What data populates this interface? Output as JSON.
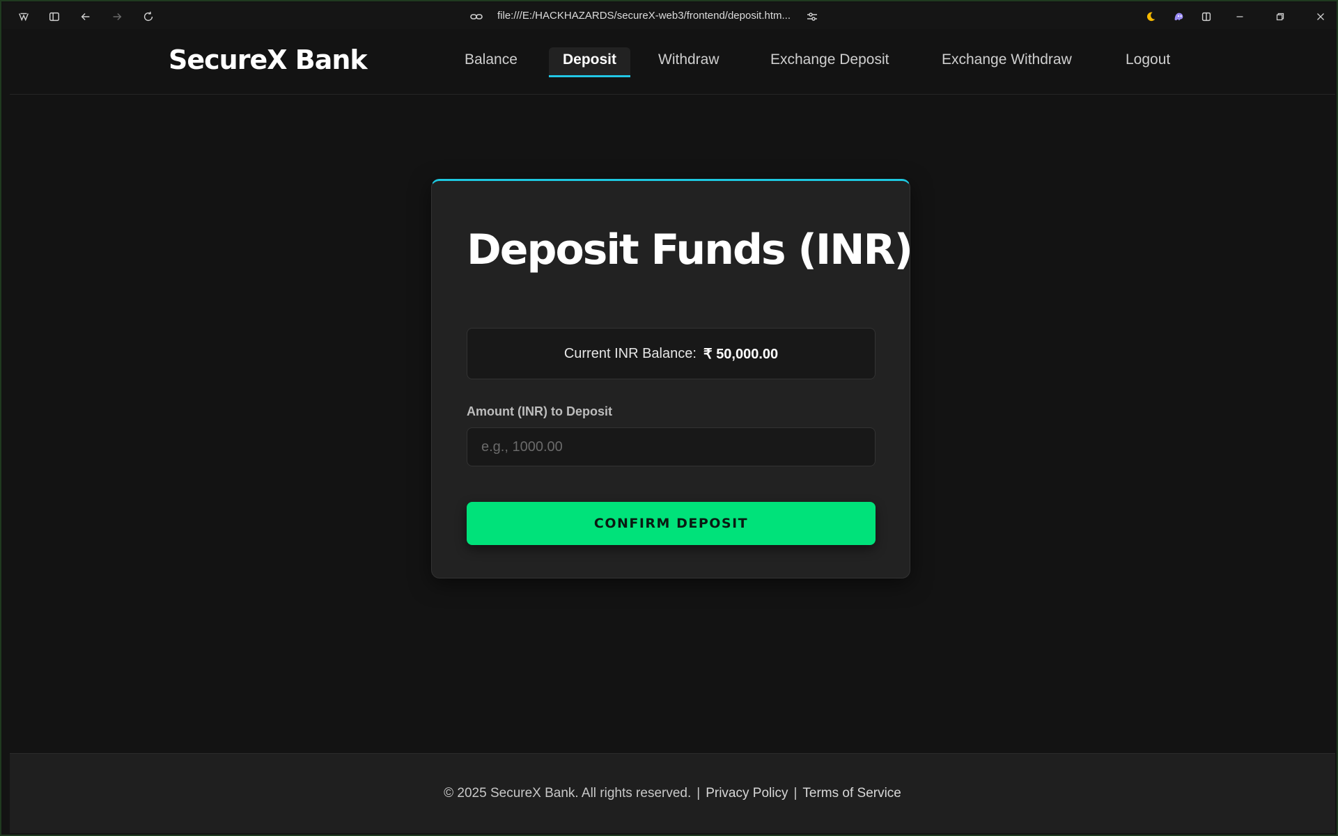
{
  "browser": {
    "url": "file:///E:/HACKHAZARDS/secureX-web3/frontend/deposit.htm..."
  },
  "site": {
    "logo": "SecureX Bank",
    "nav": [
      {
        "label": "Balance"
      },
      {
        "label": "Deposit",
        "active": true
      },
      {
        "label": "Withdraw"
      },
      {
        "label": "Exchange Deposit"
      },
      {
        "label": "Exchange Withdraw"
      },
      {
        "label": "Logout"
      }
    ]
  },
  "card": {
    "title": "Deposit Funds (INR)",
    "balance_label": "Current INR Balance:",
    "balance_value": "₹ 50,000.00",
    "amount_label": "Amount (INR) to Deposit",
    "amount_placeholder": "e.g., 1000.00",
    "amount_value": "",
    "confirm_label": "CONFIRM DEPOSIT"
  },
  "footer": {
    "copyright": "© 2025 SecureX Bank. All rights reserved.",
    "separator": "|",
    "privacy": "Privacy Policy",
    "terms": "Terms of Service"
  },
  "colors": {
    "accent": "#1ec8e0",
    "confirm": "#00e27a",
    "background": "#131313",
    "card": "#222222"
  }
}
